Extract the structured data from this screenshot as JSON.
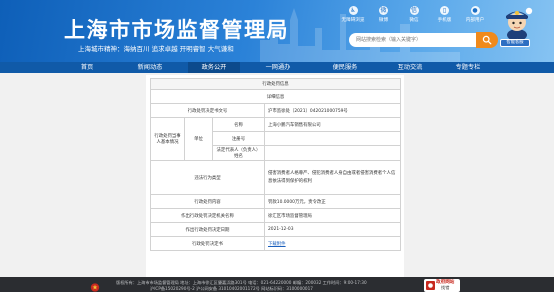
{
  "header": {
    "site_title": "上海市市场监督管理局",
    "city_spirit": "上海城市精神：海纳百川   追求卓越   开明睿智   大气谦和",
    "top_links": [
      {
        "icon": "accessibility-icon",
        "glyph": "♿",
        "label": "无障碍浏览"
      },
      {
        "icon": "weibo-icon",
        "glyph": "微",
        "label": "微博"
      },
      {
        "icon": "wechat-icon",
        "glyph": "信",
        "label": "微信"
      },
      {
        "icon": "mobile-icon",
        "glyph": "▯",
        "label": "手机版"
      },
      {
        "icon": "user-icon",
        "glyph": "●",
        "label": "内部用户"
      }
    ],
    "search_placeholder": "网站搜索检索（输入关键字）",
    "mascot_label": "智能客服"
  },
  "nav": {
    "items": [
      {
        "label": "首页",
        "active": false
      },
      {
        "label": "新闻动态",
        "active": false
      },
      {
        "label": "政务公开",
        "active": true
      },
      {
        "label": "一网通办",
        "active": false
      },
      {
        "label": "便民服务",
        "active": false
      },
      {
        "label": "互动交流",
        "active": false
      },
      {
        "label": "专题专栏",
        "active": false
      }
    ]
  },
  "detail": {
    "table_title": "行政处罚信息",
    "section_title": "详细信息",
    "rows": {
      "decision_no_label": "行政处罚决定书文号",
      "decision_no_value": "沪市监徐处〔2021〕042021000759号",
      "party_label": "行政处罚当事人基本情况",
      "org_label": "单位",
      "name_label": "名称",
      "name_value": "上海小鹏汽车销售有限公司",
      "reg_label": "注册号",
      "reg_value": "",
      "legal_rep_label": "法定代表人（负责人）姓名",
      "legal_rep_value": "",
      "violation_label": "违法行为类型",
      "violation_value": "侵害消费者人格尊严、侵犯消费者人身自由或者侵害消费者个人信息依法得到保护的权利",
      "content_label": "行政处罚内容",
      "content_value": "罚款10.0000万元，责令改正",
      "org_name_label": "作出行政处罚决定机关名称",
      "org_name_value": "徐汇区市场监督管理局",
      "date_label": "作出行政处罚决定日期",
      "date_value": "2021-12-03",
      "doc_label": "行政处罚决定书",
      "doc_value": "下载附件"
    }
  },
  "footer": {
    "line1": "版权所有：上海市市场监督管理局    地址：上海市徐汇区肇嘉浜路301号    电话：021-64220000    邮编：200032    工作时间：9:00-17:30",
    "line2": "沪ICP备15020290号-2        沪公网安备 31010402001172号        网站标识码：3100000017",
    "gov_badge_top": "政府网站",
    "gov_badge_bottom": "找错"
  },
  "colors": {
    "header_start": "#0e5fb8",
    "nav_bg": "#105aa8",
    "nav_active": "#0c4a8c",
    "search_button": "#f08a1c",
    "link": "#1a5fbd",
    "footer_bg": "#2b2d31"
  }
}
